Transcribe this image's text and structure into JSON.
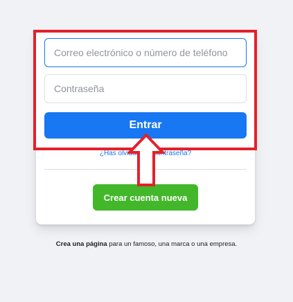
{
  "login": {
    "email_placeholder": "Correo electrónico o número de teléfono",
    "password_placeholder": "Contraseña",
    "login_label": "Entrar",
    "forgot_label": "¿Has olvidado la contraseña?",
    "create_account_label": "Crear cuenta nueva"
  },
  "footer": {
    "create_page_bold": "Crea una página",
    "create_page_rest": " para un famoso, una marca o una empresa."
  },
  "annotation": {
    "highlight_color": "#e3212b",
    "arrow_icon": "up-arrow-outline"
  },
  "colors": {
    "primary": "#1877f2",
    "success": "#42b72a",
    "background": "#f0f2f5"
  }
}
